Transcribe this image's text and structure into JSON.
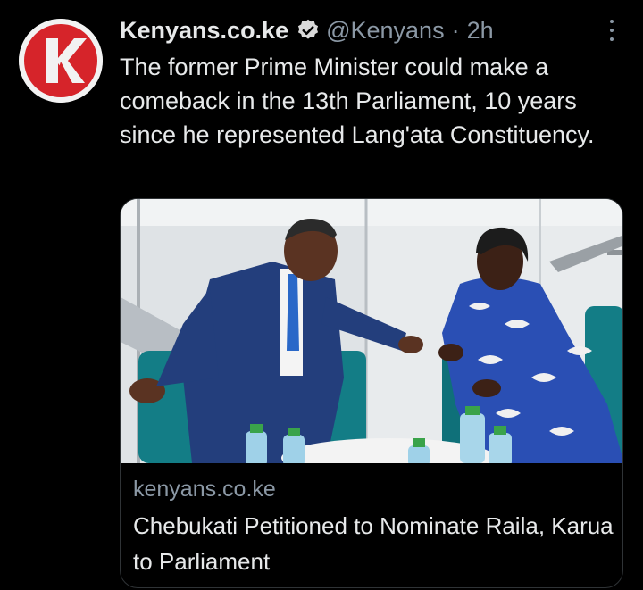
{
  "tweet": {
    "author_name": "Kenyans.co.ke",
    "handle": "@Kenyans",
    "separator": "·",
    "time": "2h",
    "verified_icon": "verified-badge-icon",
    "more_icon": "more-options-icon",
    "text": "The former Prime Minister could make a comeback in the 13th Parliament, 10 years since he represented Lang'ata Constituency."
  },
  "avatar": {
    "brand_color": "#d6242a",
    "logo": "kenyans-logo"
  },
  "link_card": {
    "domain": "kenyans.co.ke",
    "title": "Chebukati Petitioned to Nominate Raila, Karua to Parliament"
  },
  "colors": {
    "background": "#000000",
    "text": "#e7e9ea",
    "secondary": "#8b98a5",
    "verified": "#d9d9d9"
  }
}
